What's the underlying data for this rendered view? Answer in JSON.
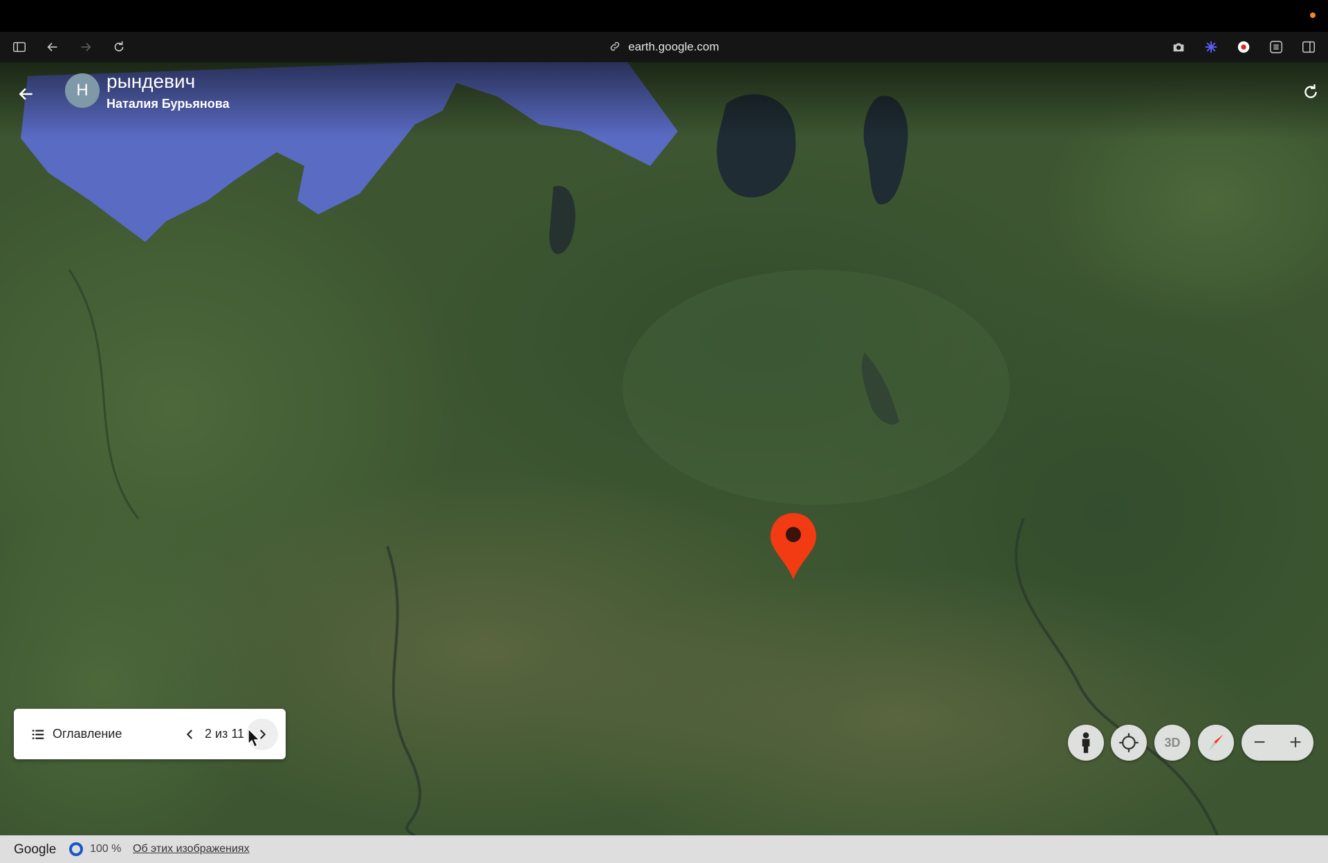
{
  "browser": {
    "url": "earth.google.com",
    "icons": [
      "sidebar-icon",
      "back-arrow-icon",
      "forward-arrow-icon",
      "reload-icon",
      "link-icon",
      "camera-icon",
      "extension-icon",
      "record-icon",
      "menu-icon",
      "split-view-icon"
    ]
  },
  "project": {
    "avatar_letter": "Н",
    "title": "рындевич",
    "author": "Наталия Бурьянова"
  },
  "story_nav": {
    "toc_label": "Оглавление",
    "page_indicator": "2 из 11"
  },
  "controls": {
    "three_d_label": "3D",
    "zoom_out": "−",
    "zoom_in": "+"
  },
  "status": {
    "brand": "Google",
    "percent": "100 %",
    "about_link": "Об этих изображениях"
  },
  "colors": {
    "pin": "#f23b13",
    "water": "#5a6bc4",
    "land": "#3f5a32"
  }
}
